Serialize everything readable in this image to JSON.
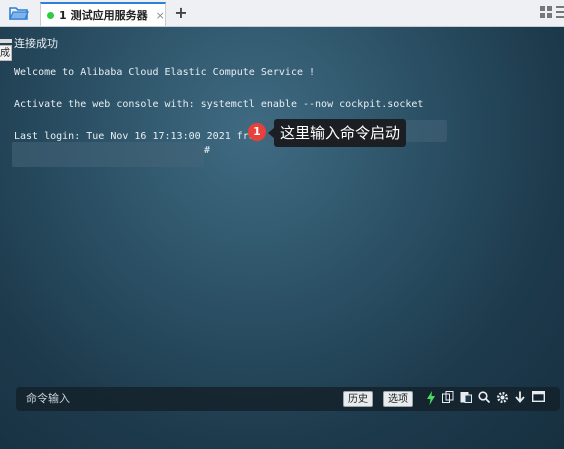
{
  "tabbar": {
    "tab": {
      "index": "1",
      "title": "测试应用服务器",
      "close": "×"
    },
    "add_tab": "+"
  },
  "terminal": {
    "side_tag": "成",
    "lines": [
      "连接成功",
      "Welcome to Alibaba Cloud Elastic Compute Service !",
      "Activate the web console with: systemctl enable --now cockpit.socket",
      "Last login: Tue Nov 16 17:13:00 2021 from"
    ],
    "prompt": "#"
  },
  "annotation": {
    "number": "1",
    "text": "这里输入命令启动"
  },
  "cmdbar": {
    "placeholder": "命令输入",
    "history_label": "历史",
    "options_label": "选项"
  },
  "colors": {
    "tab_accent": "#2f7fd8",
    "status_dot": "#2ecc40",
    "badge": "#e8413b",
    "callout_bg": "#1b1f24",
    "bolt": "#4cd964"
  }
}
